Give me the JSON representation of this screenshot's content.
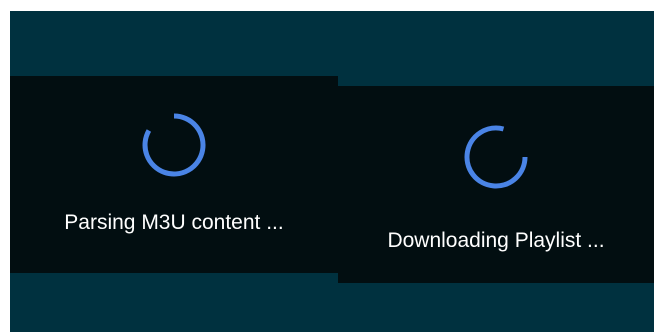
{
  "colors": {
    "frame_background": "#00313f",
    "dialog_background": "#020e11",
    "spinner_accent": "#4a84e6",
    "text": "#ffffff"
  },
  "panels": [
    {
      "icon": "progress-spinner-icon",
      "message": "Parsing M3U content ..."
    },
    {
      "icon": "progress-spinner-icon",
      "message": "Downloading Playlist ..."
    }
  ]
}
